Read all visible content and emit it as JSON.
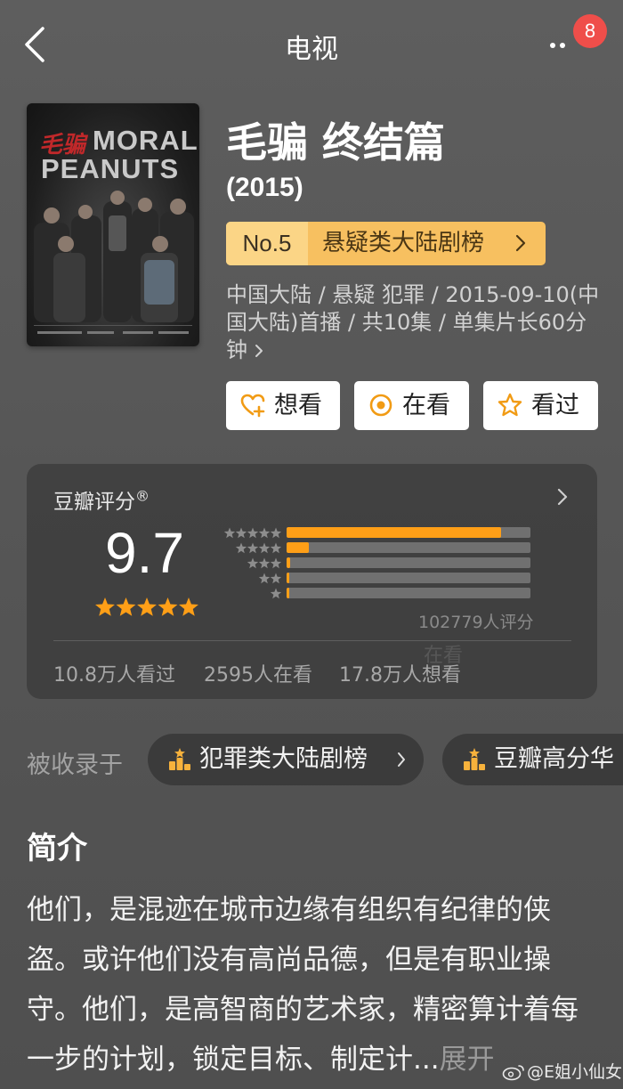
{
  "nav": {
    "title": "电视",
    "badge_count": "8",
    "back_icon": "chevron-left-icon",
    "more_icon": "more-dots-icon"
  },
  "show": {
    "title": "毛骗 终结篇",
    "year": "(2015)",
    "poster": {
      "title_cn": "毛骗",
      "title_en_1": "MORAL",
      "title_en_2": "PEANUTS"
    },
    "rank": {
      "number": "No.5",
      "label": "悬疑类大陆剧榜"
    },
    "meta": "中国大陆 / 悬疑 犯罪 / 2015-09-10(中国大陆)首播 / 共10集 / 单集片长60分钟",
    "actions": [
      {
        "label": "想看",
        "icon": "heart-plus-icon"
      },
      {
        "label": "在看",
        "icon": "target-icon"
      },
      {
        "label": "看过",
        "icon": "star-outline-icon"
      }
    ]
  },
  "rating": {
    "label": "豆瓣评分",
    "registered": "®",
    "score": "9.7",
    "stars": 5,
    "distribution": [
      {
        "stars": 5,
        "fraction": 0.88
      },
      {
        "stars": 4,
        "fraction": 0.09
      },
      {
        "stars": 3,
        "fraction": 0.015
      },
      {
        "stars": 2,
        "fraction": 0.006
      },
      {
        "stars": 1,
        "fraction": 0.006
      }
    ],
    "count": "102779人评分",
    "ghost_text": "在看",
    "stats": [
      "10.8万人看过",
      "2595人在看",
      "17.8万人想看"
    ]
  },
  "collections": {
    "label": "被收录于",
    "items": [
      "犯罪类大陆剧榜",
      "豆瓣高分华"
    ]
  },
  "intro": {
    "heading": "简介",
    "text": "他们，是混迹在城市边缘有组织有纪律的侠盗。或许他们没有高尚品德，但是有职业操守。他们，是高智商的艺术家，精密算计着每一步的计划，锁定目标、制定计...",
    "expand": "展开"
  },
  "watermark": "@E姐小仙女",
  "colors": {
    "accent": "#ff9f17",
    "badge": "#ef4e4a",
    "rank_bg": "#f7c060",
    "rank_no_bg": "#fbd586"
  }
}
